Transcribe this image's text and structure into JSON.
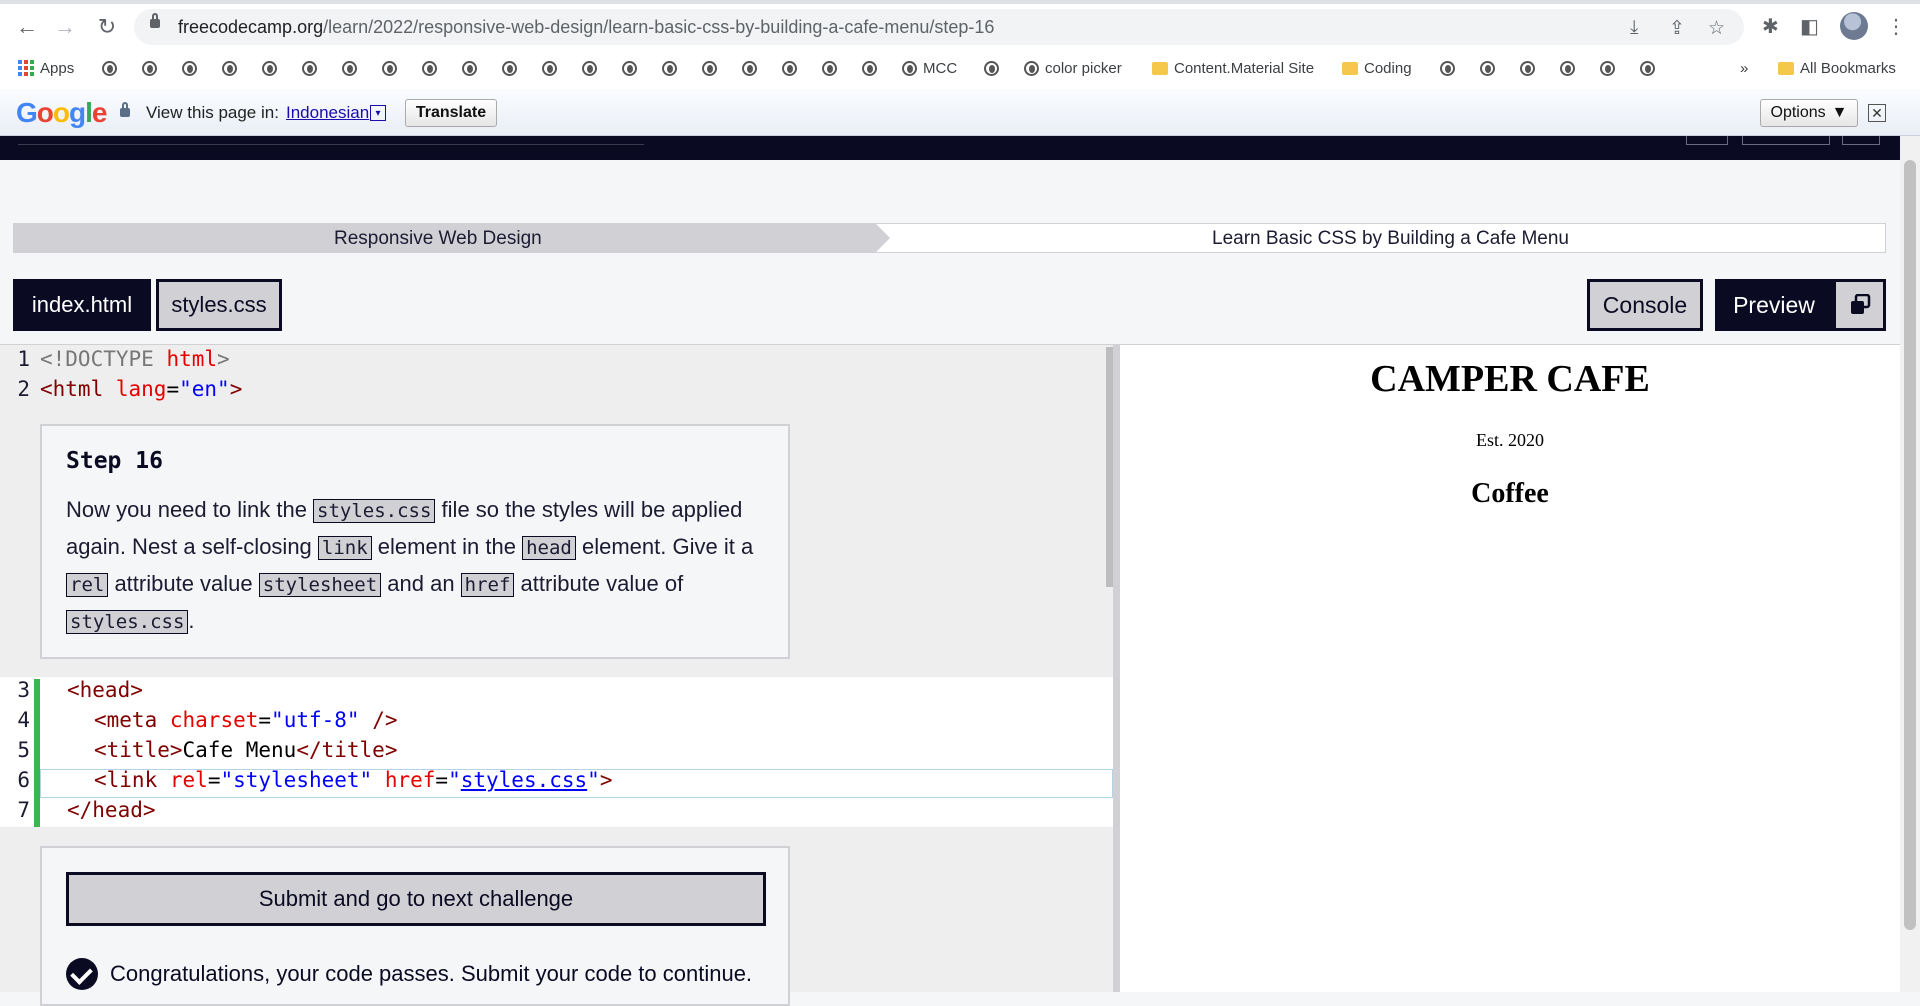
{
  "browser": {
    "url_domain": "freecodecamp.org",
    "url_path": "/learn/2022/responsive-web-design/learn-basic-css-by-building-a-cafe-menu/step-16",
    "bookmarks": {
      "apps": "Apps",
      "mcc": "MCC",
      "color_picker": "color picker",
      "content_material": "Content.Material Site",
      "coding": "Coding",
      "overflow": "»",
      "all_bookmarks": "All Bookmarks"
    }
  },
  "translate_bar": {
    "logo": "Google",
    "prompt": "View this page in:",
    "language": "Indonesian",
    "caret": "▾",
    "translate_button": "Translate",
    "options_button": "Options",
    "options_caret": "▼",
    "close": "✕"
  },
  "breadcrumb": {
    "superblock": "Responsive Web Design",
    "block": "Learn Basic CSS by Building a Cafe Menu"
  },
  "tabs": {
    "index": "index.html",
    "styles": "styles.css",
    "console": "Console",
    "preview": "Preview"
  },
  "editor": {
    "line_numbers": [
      "1",
      "2",
      "3",
      "4",
      "5",
      "6",
      "7"
    ],
    "line1": {
      "doctype": "<!DOCTYPE ",
      "html": "html",
      "close": ">"
    },
    "line2": {
      "open": "<html",
      "attr": "lang",
      "eq": "=",
      "val": "\"en\"",
      "close": ">"
    },
    "line3": {
      "text": "<head>"
    },
    "line4": {
      "open": "<meta",
      "attr": "charset",
      "eq": "=",
      "val": "\"utf-8\"",
      "close": " />"
    },
    "line5": {
      "open": "<title>",
      "text": "Cafe Menu",
      "close": "</title>"
    },
    "line6": {
      "open": "<link",
      "attr1": "rel",
      "eq1": "=",
      "val1": "\"stylesheet\"",
      "attr2": "href",
      "eq2": "=",
      "q1": "\"",
      "val2": "styles.css",
      "q2": "\"",
      "close": ">"
    },
    "line7": {
      "text": "</head>"
    }
  },
  "step": {
    "title": "Step 16",
    "desc": {
      "t1": "Now you need to link the ",
      "c1": "styles.css",
      "t2": " file so the styles will be applied again. Nest a self-closing ",
      "c2": "link",
      "t3": " element in the ",
      "c3": "head",
      "t4": " element. Give it a ",
      "c4": "rel",
      "t5": " attribute value ",
      "c5": "stylesheet",
      "t6": " and an ",
      "c6": "href",
      "t7": " attribute value of ",
      "c7": "styles.css",
      "t8": "."
    }
  },
  "actions": {
    "submit": "Submit and go to next challenge",
    "congrats": "Congratulations, your code passes. Submit your code to continue."
  },
  "preview": {
    "title": "CAMPER CAFE",
    "est": "Est. 2020",
    "section": "Coffee"
  }
}
